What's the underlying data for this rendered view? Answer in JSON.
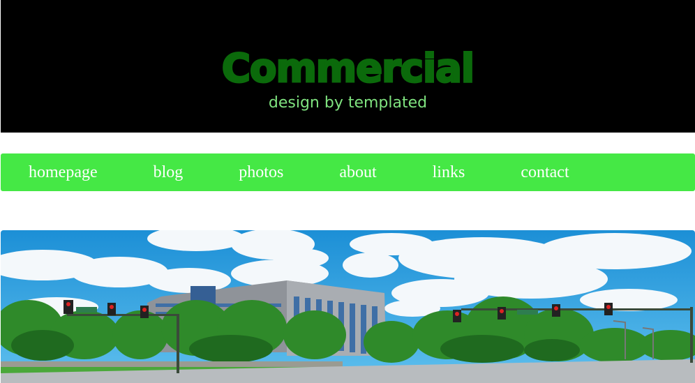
{
  "header": {
    "title": "Commercial",
    "tagline": "design by templated"
  },
  "menu": {
    "items": [
      {
        "label": "homepage"
      },
      {
        "label": "blog"
      },
      {
        "label": "photos"
      },
      {
        "label": "about"
      },
      {
        "label": "links"
      },
      {
        "label": "contact"
      }
    ]
  },
  "colors": {
    "header_bg": "#000000",
    "title": "#0b6a0b",
    "tagline": "#7fe37f",
    "menu_bg": "#45e845",
    "menu_text": "#ffffff"
  }
}
